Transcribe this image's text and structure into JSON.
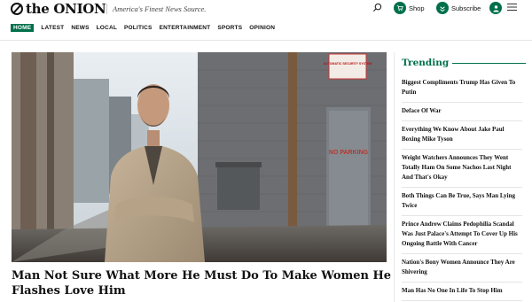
{
  "header": {
    "logo_text": "the ONION",
    "tagline": "America's Finest News Source.",
    "shop_label": "Shop",
    "subscribe_label": "Subscribe"
  },
  "nav": {
    "items": [
      {
        "label": "HOME",
        "active": true
      },
      {
        "label": "LATEST"
      },
      {
        "label": "NEWS"
      },
      {
        "label": "LOCAL"
      },
      {
        "label": "POLITICS"
      },
      {
        "label": "ENTERTAINMENT"
      },
      {
        "label": "SPORTS"
      },
      {
        "label": "OPINION"
      }
    ]
  },
  "main": {
    "headline": "Man Not Sure What More He Must Do To Make Women He Flashes Love Him",
    "image_text": {
      "sign": "AUTOMATIC SECURITY SYSTEM",
      "door": "NO PARKING"
    }
  },
  "trending": {
    "title": "Trending",
    "items": [
      "Biggest Compliments Trump Has Given To Putin",
      "Deface Of War",
      "Everything We Know About Jake Paul Boxing Mike Tyson",
      "Weight Watchers Announces They Went Totally Ham On Some Nachos Last Night And That's Okay",
      "Both Things Can Be True, Says Man Lying Twice",
      "Prince Andrew Claims Pedophilia Scandal Was Just Palace's Attempt To Cover Up His Ongoing Battle With Cancer",
      "Nation's Bony Women Announce They Are Shivering",
      "Man Has No One In Life To Stop Him"
    ]
  },
  "colors": {
    "brand_green": "#00704a"
  }
}
